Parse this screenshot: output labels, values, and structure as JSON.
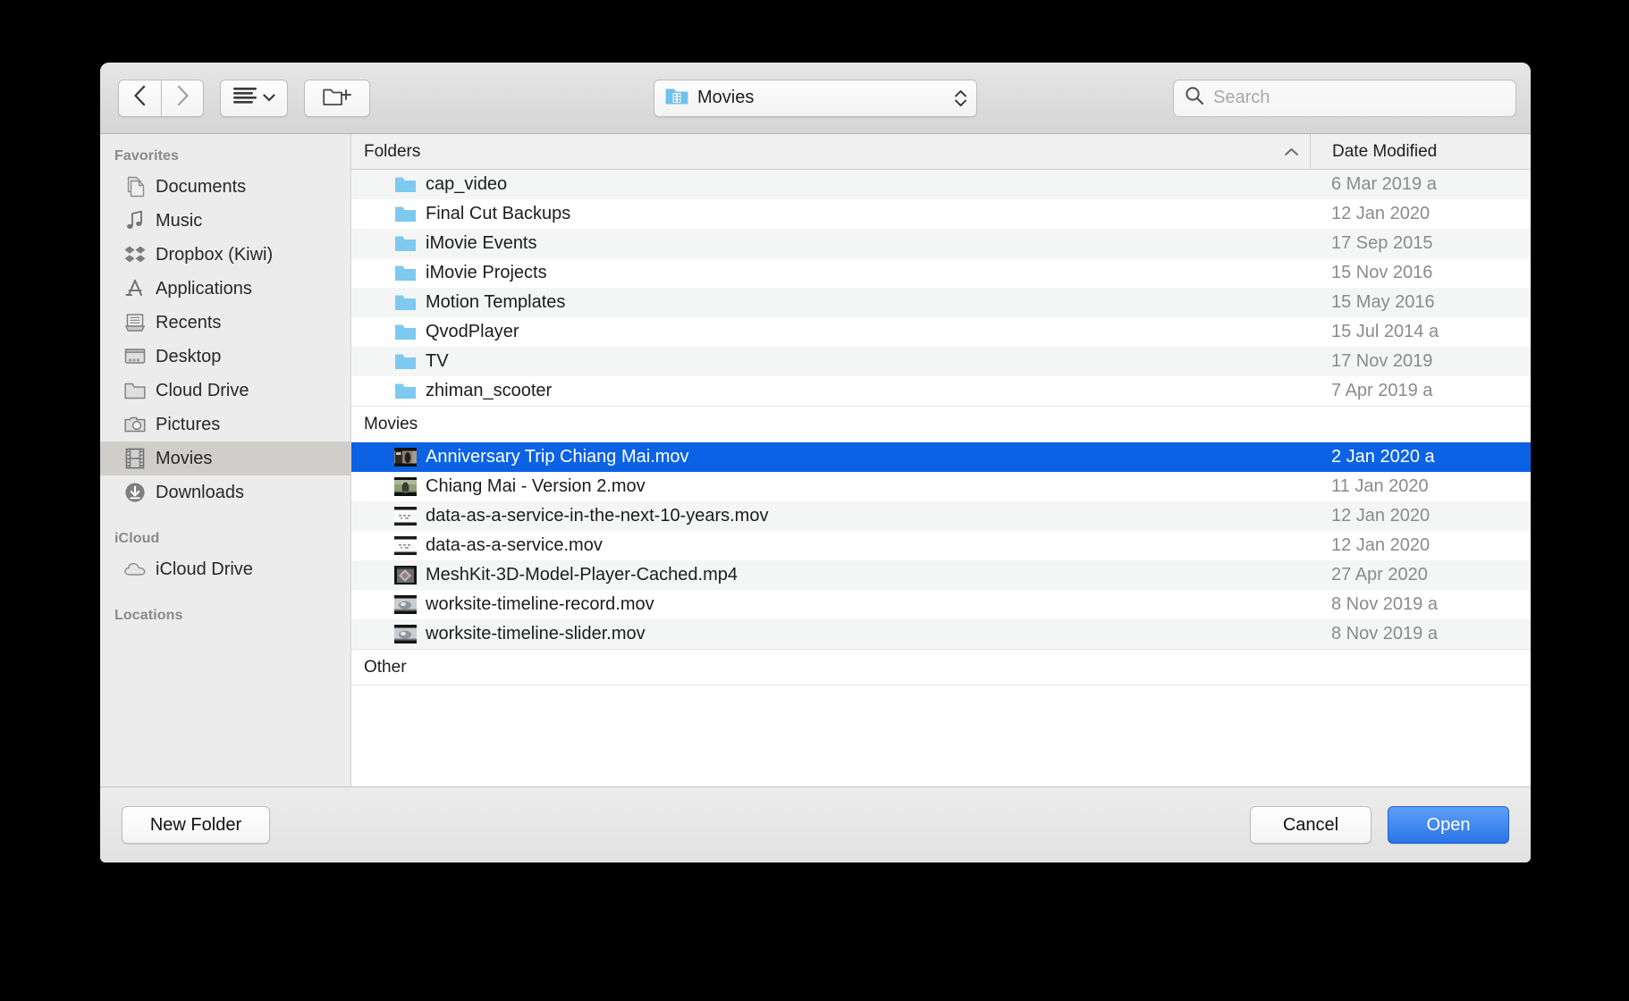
{
  "window": {
    "title": "Open File Dialog"
  },
  "toolbar": {
    "back_icon": "chevron-left-icon",
    "forward_icon": "chevron-right-icon",
    "view_mode_label": "list-view",
    "new_folder_icon": "new-folder-icon",
    "path": {
      "icon": "movies-folder-icon",
      "label": "Movies"
    },
    "search": {
      "icon": "search-icon",
      "placeholder": "Search",
      "value": ""
    }
  },
  "sidebar": {
    "sections": [
      {
        "header": "Favorites",
        "items": [
          {
            "label": "Documents",
            "icon": "documents-icon",
            "selected": false
          },
          {
            "label": "Music",
            "icon": "music-note-icon",
            "selected": false
          },
          {
            "label": "Dropbox (Kiwi)",
            "icon": "dropbox-icon",
            "selected": false
          },
          {
            "label": "Applications",
            "icon": "appstore-a-icon",
            "selected": false
          },
          {
            "label": "Recents",
            "icon": "recents-icon",
            "selected": false
          },
          {
            "label": "Desktop",
            "icon": "desktop-icon",
            "selected": false
          },
          {
            "label": "Cloud Drive",
            "icon": "folder-icon",
            "selected": false
          },
          {
            "label": "Pictures",
            "icon": "camera-icon",
            "selected": false
          },
          {
            "label": "Movies",
            "icon": "film-icon",
            "selected": true
          },
          {
            "label": "Downloads",
            "icon": "download-icon",
            "selected": false
          }
        ]
      },
      {
        "header": "iCloud",
        "items": [
          {
            "label": "iCloud Drive",
            "icon": "cloud-icon",
            "selected": false
          }
        ]
      },
      {
        "header": "Locations",
        "items": []
      }
    ]
  },
  "file_list": {
    "columns": {
      "name": "Folders",
      "date": "Date Modified",
      "sort_indicator": "chevron-up-icon"
    },
    "groups": [
      {
        "name": "Folders",
        "is_column_header": true,
        "rows": [
          {
            "name": "cap_video",
            "date": "6 Mar 2019 a",
            "icon": "folder-icon",
            "selected": false
          },
          {
            "name": "Final Cut Backups",
            "date": "12 Jan 2020",
            "icon": "folder-icon",
            "selected": false
          },
          {
            "name": "iMovie Events",
            "date": "17 Sep 2015",
            "icon": "folder-icon",
            "selected": false
          },
          {
            "name": "iMovie Projects",
            "date": "15 Nov 2016",
            "icon": "folder-icon",
            "selected": false
          },
          {
            "name": "Motion Templates",
            "date": "15 May 2016",
            "icon": "folder-icon",
            "selected": false
          },
          {
            "name": "QvodPlayer",
            "date": "15 Jul 2014 a",
            "icon": "folder-icon",
            "selected": false
          },
          {
            "name": "TV",
            "date": "17 Nov 2019",
            "icon": "folder-icon",
            "selected": false
          },
          {
            "name": "zhiman_scooter",
            "date": "7 Apr 2019 a",
            "icon": "folder-icon",
            "selected": false
          }
        ]
      },
      {
        "name": "Movies",
        "is_column_header": false,
        "rows": [
          {
            "name": "Anniversary Trip Chiang Mai.mov",
            "date": "2 Jan 2020 a",
            "icon": "video-thumb-person-icon",
            "selected": true
          },
          {
            "name": "Chiang Mai - Version 2.mov",
            "date": "11 Jan 2020",
            "icon": "video-thumb-person-icon",
            "selected": false
          },
          {
            "name": "data-as-a-service-in-the-next-10-years.mov",
            "date": "12 Jan 2020",
            "icon": "video-thumb-slide-icon",
            "selected": false
          },
          {
            "name": "data-as-a-service.mov",
            "date": "12 Jan 2020",
            "icon": "video-thumb-slide-icon",
            "selected": false
          },
          {
            "name": "MeshKit-3D-Model-Player-Cached.mp4",
            "date": "27 Apr 2020",
            "icon": "video-thumb-mesh-icon",
            "selected": false
          },
          {
            "name": "worksite-timeline-record.mov",
            "date": "8 Nov 2019 a",
            "icon": "video-thumb-site-icon",
            "selected": false
          },
          {
            "name": "worksite-timeline-slider.mov",
            "date": "8 Nov 2019 a",
            "icon": "video-thumb-site-icon",
            "selected": false
          }
        ]
      },
      {
        "name": "Other",
        "is_column_header": false,
        "rows": []
      }
    ]
  },
  "footer": {
    "new_folder_label": "New Folder",
    "cancel_label": "Cancel",
    "open_label": "Open"
  },
  "colors": {
    "selection_blue": "#0b62e4",
    "primary_button_blue": "#2a74e8",
    "folder_blue": "#7dc9f0",
    "sidebar_bg": "#ececec",
    "row_stripe": "#f4f5f5"
  }
}
